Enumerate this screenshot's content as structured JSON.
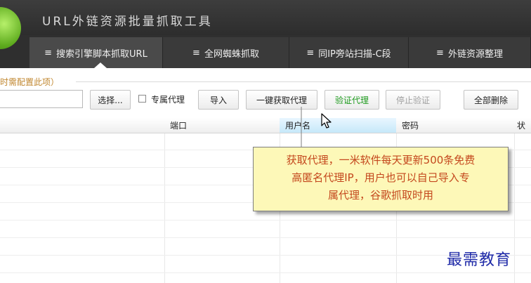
{
  "app": {
    "title": "URL外链资源批量抓取工具"
  },
  "tabs": [
    {
      "label": "搜索引擎脚本抓取URL",
      "active": true
    },
    {
      "label": "全网蜘蛛抓取",
      "active": false
    },
    {
      "label": "同IP旁站扫描-C段",
      "active": false
    },
    {
      "label": "外链资源整理",
      "active": false
    }
  ],
  "tab_icon": "≡",
  "config_note": "时需配置此项）",
  "buttons": {
    "select": "选择...",
    "dedicated_proxy": "专属代理",
    "import": "导入",
    "get_proxy": "一键获取代理",
    "verify": "验证代理",
    "stop_verify": "停止验证",
    "delete_all": "全部删除"
  },
  "table": {
    "columns": [
      "端口",
      "用户名",
      "密码",
      "状"
    ]
  },
  "tooltip": {
    "line1": "获取代理，一米软件每天更新500条免费",
    "line2": "高匿名代理IP，用户也可以自己导入专",
    "line3": "属代理，谷歌抓取时用"
  },
  "watermark": "最需教育",
  "colors": {
    "accent_green": "#1e9a1e",
    "note_orange": "#c0862e",
    "tooltip_text": "#c4471d",
    "tooltip_bg": "#fdf8b8",
    "header": "#2f2f2f"
  }
}
